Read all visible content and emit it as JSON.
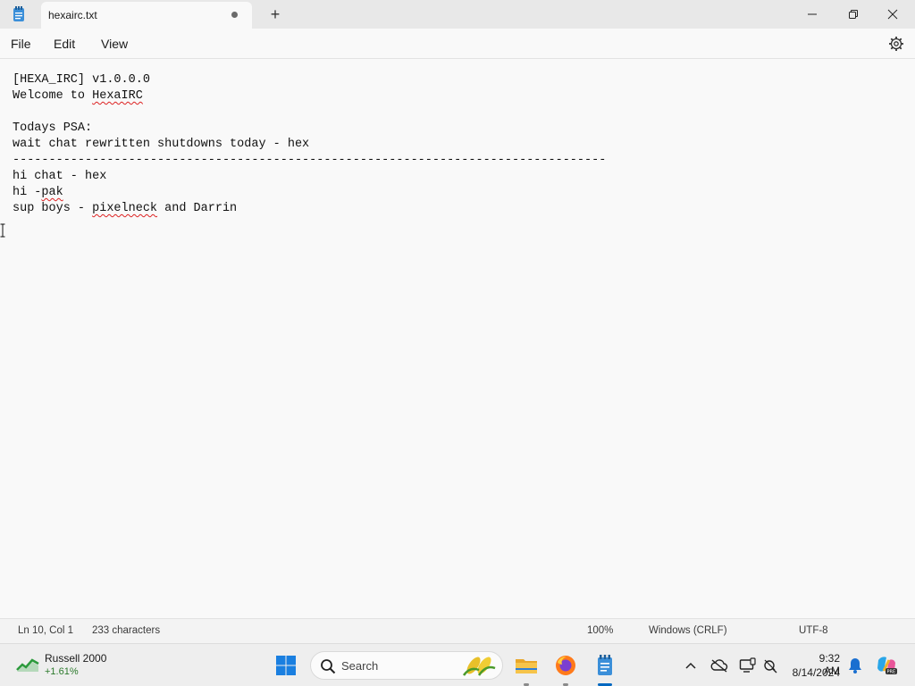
{
  "window": {
    "tab_title": "hexairc.txt",
    "new_tab": "+"
  },
  "menu": {
    "file": "File",
    "edit": "Edit",
    "view": "View"
  },
  "editor": {
    "lines": [
      "[HEXA_IRC] v1.0.0.0",
      "Welcome to HexaIRC",
      "",
      "Todays PSA:",
      "wait chat rewritten shutdowns today - hex",
      "----------------------------------------------------------------------------------",
      "hi chat - hex",
      "hi -pak",
      "sup boys - pixelneck and Darrin"
    ],
    "segments": {
      "l2a": "Welcome to ",
      "l2b": "HexaIRC",
      "l8a": "hi -",
      "l8b": "pak",
      "l9a": "sup boys - ",
      "l9b": "pixelneck",
      "l9c": " and Darrin"
    }
  },
  "status": {
    "position": "Ln 10, Col 1",
    "characters": "233 characters",
    "zoom": "100%",
    "line_ending": "Windows (CRLF)",
    "encoding": "UTF-8"
  },
  "taskbar": {
    "widget_title": "Russell 2000",
    "widget_change": "+1.61%",
    "search_label": "Search",
    "time": "9:32 AM",
    "date": "8/14/2024",
    "icons": [
      "start-icon",
      "search-icon",
      "file-explorer-icon",
      "firefox-icon",
      "notepad-icon",
      "chevron-up-icon",
      "onedrive-icon",
      "display-icon",
      "status-icon",
      "bell-icon",
      "copilot-icon"
    ]
  },
  "colors": {
    "accent": "#0067c0",
    "spell_squiggle": "#dd2222",
    "positive_change": "#2c7a2c"
  }
}
